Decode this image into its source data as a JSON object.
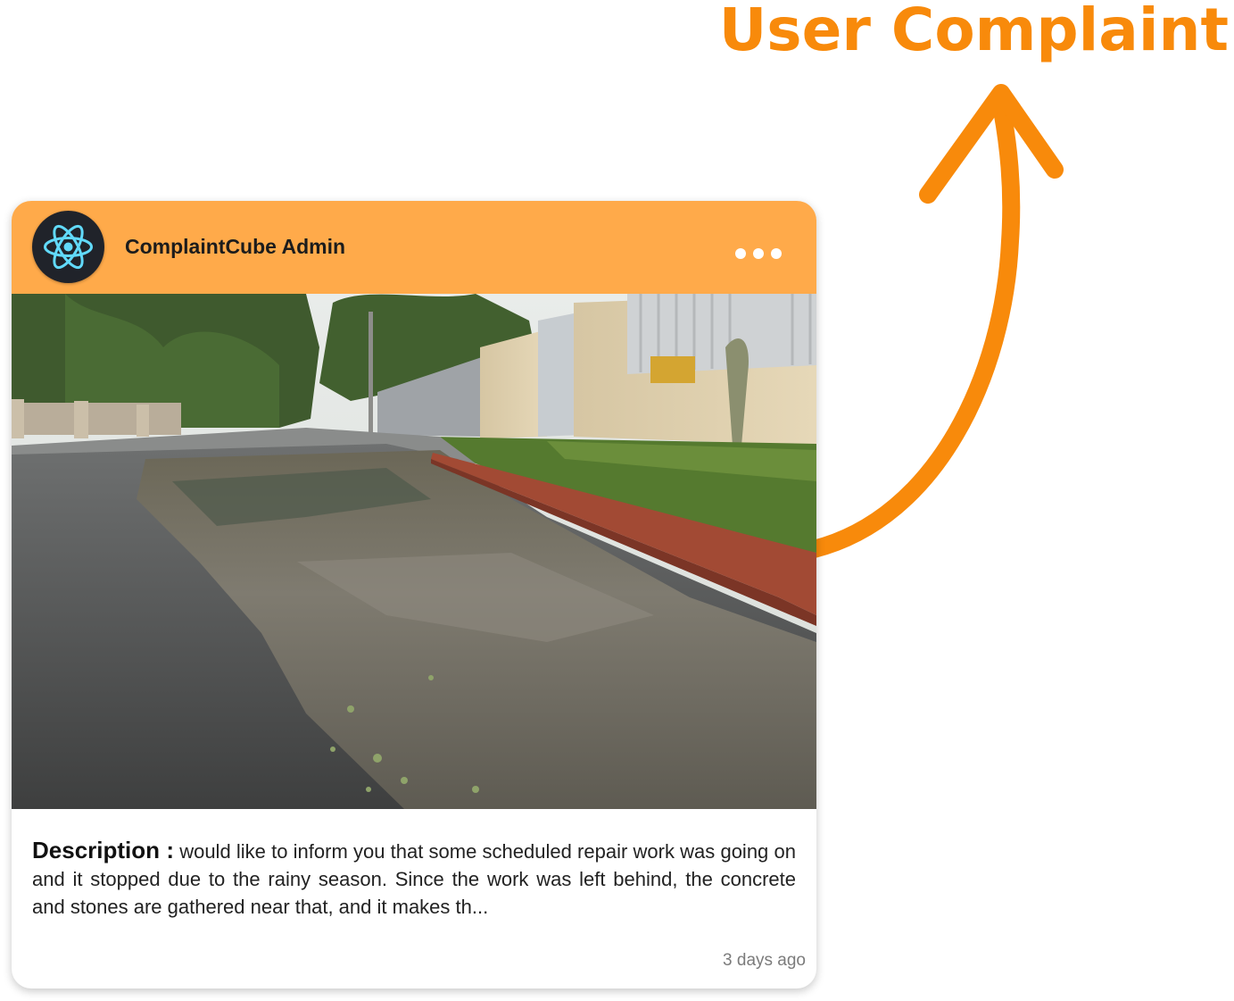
{
  "annotation": {
    "title": "User Complaint"
  },
  "card": {
    "author": {
      "name": "ComplaintCube Admin",
      "avatar_icon": "react-atom-icon"
    },
    "menu_icon": "more-horizontal-icon",
    "photo_alt": "Flooded residential street after rain",
    "description": {
      "label": "Description :",
      "text": "would like to inform you that some scheduled repair work was going on and it stopped due to the rainy season. Since the work was left behind, the concrete and stones are gathered near that, and it makes th..."
    },
    "timestamp": "3 days ago"
  },
  "colors": {
    "accent": "#F88A0B",
    "header": "#FFAA4A",
    "avatar_bg": "#20232A",
    "atom": "#61DAFB"
  }
}
